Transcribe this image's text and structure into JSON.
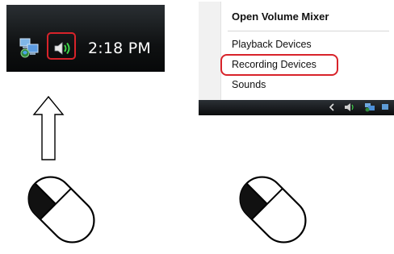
{
  "taskbar": {
    "clock": "2:18 PM",
    "icons": [
      "network-icon",
      "speaker-icon"
    ],
    "highlight_color": "#d8232a"
  },
  "context_menu": {
    "items": [
      {
        "label": "Open Volume Mixer",
        "bold": true
      },
      {
        "label": "Playback Devices",
        "bold": false
      },
      {
        "label": "Recording Devices",
        "bold": false,
        "highlighted": true
      },
      {
        "label": "Sounds",
        "bold": false
      }
    ]
  },
  "instructions": {
    "arrow": "up-arrow-icon",
    "left_mouse": {
      "pressed_button": "left"
    },
    "right_mouse": {
      "pressed_button": "left"
    }
  }
}
